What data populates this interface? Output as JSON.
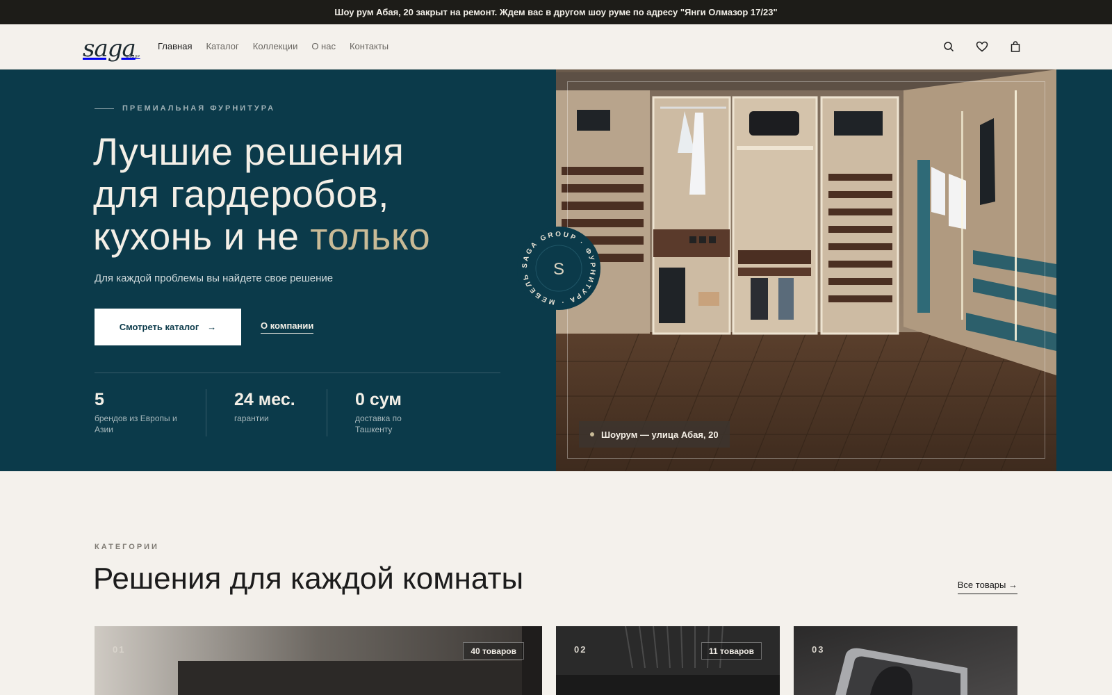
{
  "announcement": "Шоу рум Абая, 20 закрыт на ремонт. Ждем вас в другом шоу руме по адресу \"Янги Олмазор 17/23\"",
  "header": {
    "logo_text": "saga",
    "logo_sub": "GROUP",
    "nav": [
      "Главная",
      "Каталог",
      "Коллекции",
      "О нас",
      "Контакты"
    ],
    "active_nav": "Главная",
    "icons": [
      "search-icon",
      "heart-icon",
      "bag-icon"
    ]
  },
  "hero": {
    "eyebrow": "ПРЕМИАЛЬНАЯ ФУРНИТУРА",
    "title_line1": "Лучшие решения",
    "title_line2": "для гардеробов,",
    "title_line3_main": "кухонь и не ",
    "title_line3_accent": "только",
    "subtitle": "Для каждой проблемы вы найдете свое решение",
    "cta_primary": "Смотреть каталог",
    "cta_primary_arrow": "→",
    "cta_secondary": "О компании",
    "stats": [
      {
        "value": "5",
        "label": "брендов из Европы и Азии"
      },
      {
        "value": "24 мес.",
        "label": "гарантии"
      },
      {
        "value": "0 сум",
        "label": "доставка по Ташкенту"
      }
    ],
    "badge": {
      "center": "S",
      "ring_text": "SAGA GROUP · ФУРНИТУРА · МЕБЕЛЬ ·"
    },
    "showroom_chip": "Шоурум — улица Абая, 20"
  },
  "categories": {
    "eyebrow": "КАТЕГОРИИ",
    "title": "Решения для каждой комнаты",
    "all_link": "Все товары →",
    "cards": [
      {
        "index": "01",
        "count": "40 товаров"
      },
      {
        "index": "02",
        "count": "11 товаров"
      },
      {
        "index": "03",
        "count": ""
      }
    ]
  },
  "colors": {
    "hero_bg": "#0b3a4a",
    "accent": "#c9bb97",
    "page_bg": "#f4f1ec",
    "announce_bg": "#1d1c18"
  }
}
